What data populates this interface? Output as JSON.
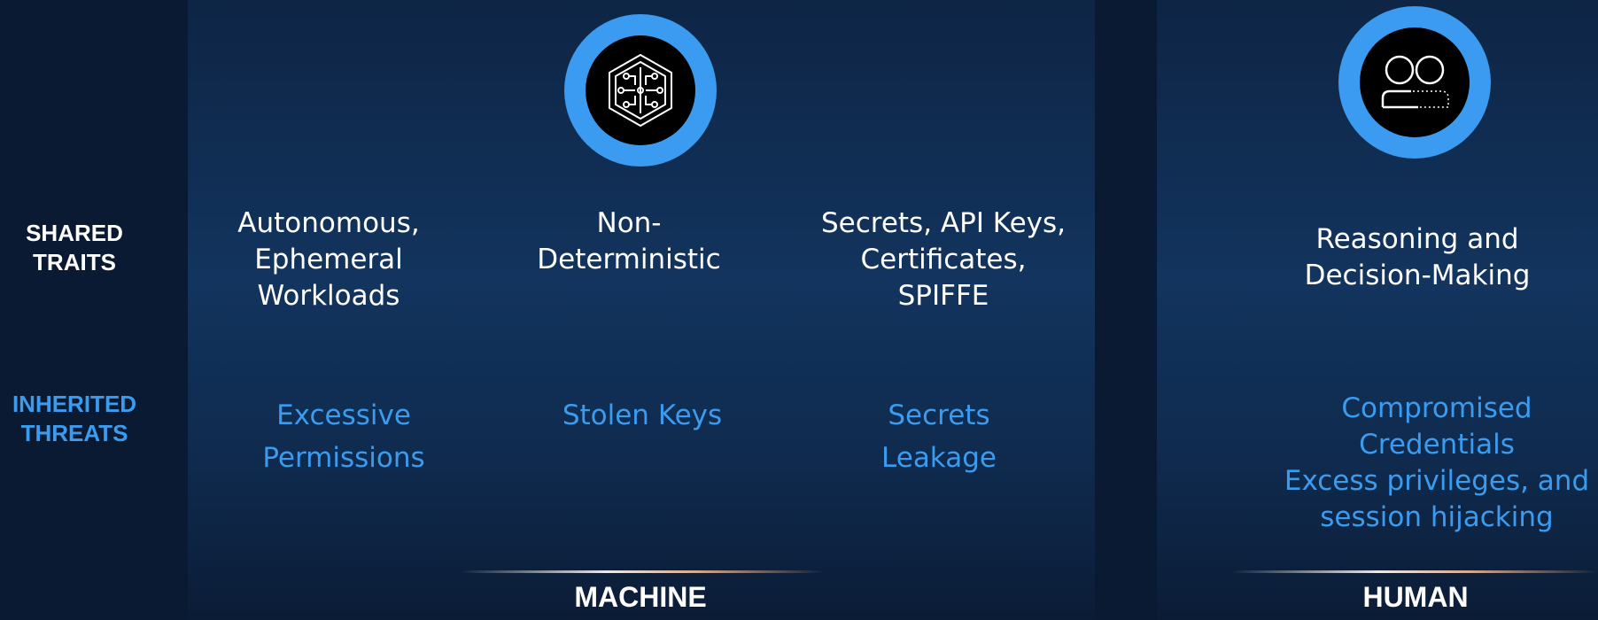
{
  "rows": {
    "shared_label": "SHARED\nTRAITS",
    "inherited_label": "INHERITED\nTHREATS"
  },
  "groups": {
    "machine": "MACHINE",
    "human": "HUMAN"
  },
  "traits": [
    "Autonomous,\nEphemeral\nWorkloads",
    "Non-\nDeterministic",
    "Secrets, API Keys,\nCertificates,\nSPIFFE",
    "Reasoning and\nDecision-Making"
  ],
  "threats": [
    "Excessive\nPermissions",
    "Stolen Keys",
    "Secrets\nLeakage",
    "Compromised\nCredentials\nExcess privileges, and\nsession hijacking"
  ],
  "icons": {
    "machine": "circuit-hexagon-icon",
    "human": "two-people-icon"
  },
  "colors": {
    "accent_blue": "#3a9bf0",
    "threat_text": "#3b9bef",
    "background": "#0a1a33",
    "panel": "#12345e"
  }
}
